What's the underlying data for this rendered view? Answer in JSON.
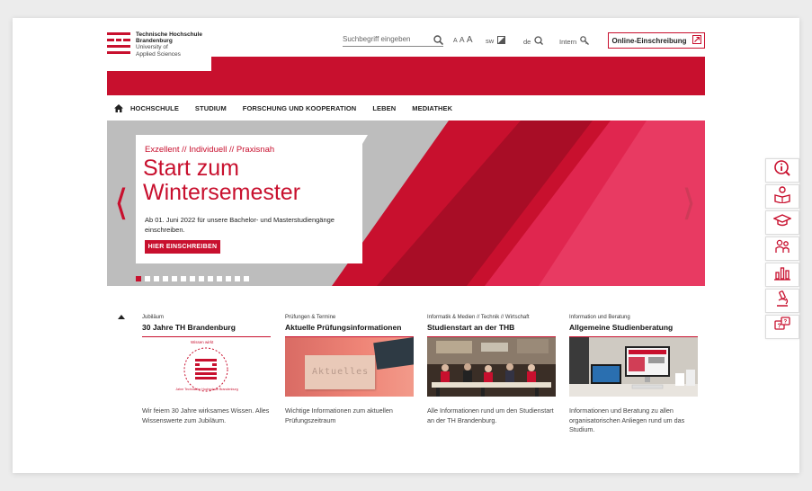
{
  "logo": {
    "line1": "Technische Hochschule",
    "line2": "Brandenburg",
    "line3": "University of",
    "line4": "Applied Sciences"
  },
  "header": {
    "search_placeholder": "Suchbegriff eingeben",
    "font_small": "A",
    "font_mid": "A",
    "font_large": "A",
    "contrast_label": "sw",
    "lang_label": "de",
    "intern_label": "Intern",
    "online_label": "Online-Einschreibung"
  },
  "nav": {
    "items": [
      "HOCHSCHULE",
      "STUDIUM",
      "FORSCHUNG UND KOOPERATION",
      "LEBEN",
      "MEDIATHEK"
    ]
  },
  "hero": {
    "tagline": "Exzellent // Individuell // Praxisnah",
    "title": "Start zum Wintersemester",
    "text": "Ab 01. Juni 2022 für unsere Bachelor- und Masterstudiengänge einschreiben.",
    "cta": "HIER EINSCHREIBEN",
    "arrow_left": "⟨",
    "arrow_right": "⟩",
    "slides_total": 13,
    "slide_active": 1
  },
  "teasers": [
    {
      "category": "Jubiläum",
      "title": "30 Jahre TH Brandenburg",
      "description": "Wir feiern 30 Jahre wirksames Wissen. Alles Wissenswerte zum Jubiläum.",
      "badge_top": "Wissen wirkt",
      "badge_num": "30",
      "badge_ring": "Jahre Technische Hochschule Brandenburg"
    },
    {
      "category": "Prüfungen & Termine",
      "title": "Aktuelle Prüfungsinformationen",
      "description": "Wichtige Informationen zum aktuellen Prüfungszeitraum",
      "image_text": "Aktuelles"
    },
    {
      "category": "Informatik & Medien // Technik // Wirtschaft",
      "title": "Studienstart an der THB",
      "description": "Alle Informationen rund um den Studienstart an der TH Brandenburg."
    },
    {
      "category": "Information und Beratung",
      "title": "Allgemeine Studienberatung",
      "description": "Informationen und Beratung zu allen organisatorischen Anliegen rund um das Studium."
    }
  ],
  "sidebar": {
    "icons": [
      "info-icon",
      "reader-icon",
      "graduation-cap-icon",
      "people-icon",
      "bar-chart-icon",
      "microscope-icon",
      "question-chat-icon"
    ]
  },
  "colors": {
    "brand_red": "#c8102e",
    "hero_gray": "#bdbdbd",
    "pink": "#e0264f"
  }
}
